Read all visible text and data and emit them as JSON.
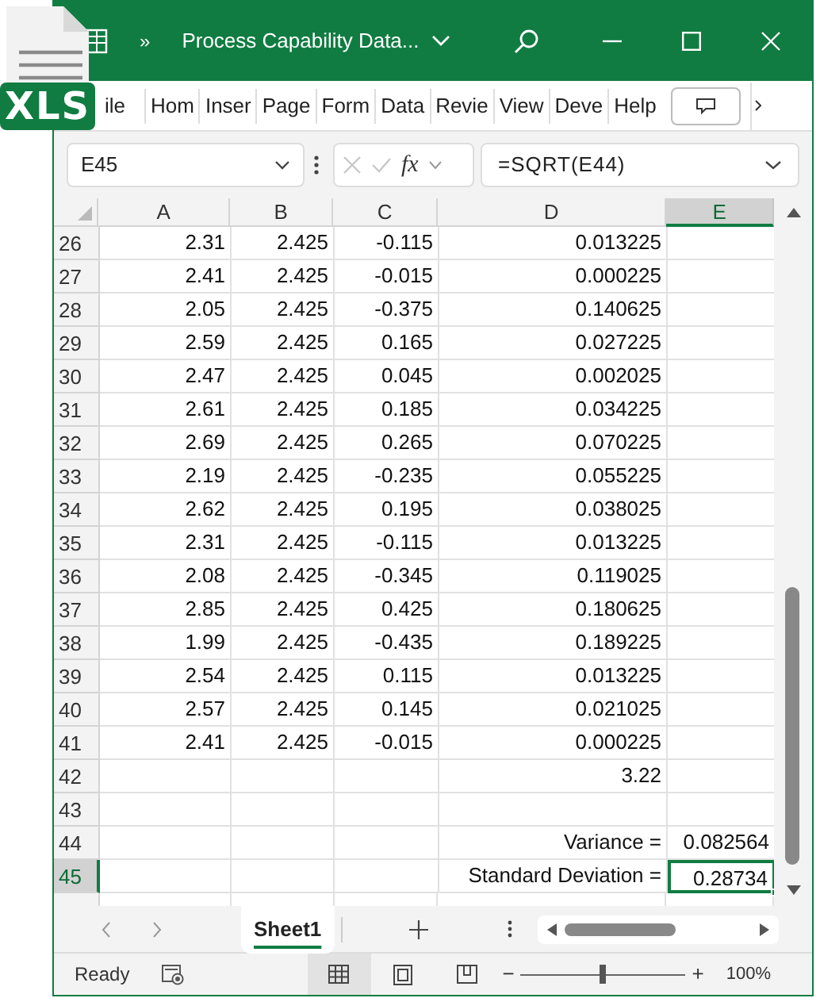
{
  "file_badge": {
    "label": "XLS"
  },
  "window": {
    "overflow": "»",
    "title": "Process Capability Data..."
  },
  "ribbon_tabs": [
    {
      "label": "ile"
    },
    {
      "label": "Hom"
    },
    {
      "label": "Inser"
    },
    {
      "label": "Page"
    },
    {
      "label": "Form"
    },
    {
      "label": "Data"
    },
    {
      "label": "Revie"
    },
    {
      "label": "View"
    },
    {
      "label": "Deve"
    },
    {
      "label": "Help"
    }
  ],
  "formula_bar": {
    "name_box": "E45",
    "fx": "fx",
    "formula": "=SQRT(E44)"
  },
  "columns": [
    {
      "label": "A",
      "selected": false
    },
    {
      "label": "B",
      "selected": false
    },
    {
      "label": "C",
      "selected": false
    },
    {
      "label": "D",
      "selected": false
    },
    {
      "label": "E",
      "selected": true
    }
  ],
  "rows": [
    {
      "number": "26",
      "selected": false,
      "cells": [
        "2.31",
        "2.425",
        "-0.115",
        "0.013225",
        ""
      ]
    },
    {
      "number": "27",
      "selected": false,
      "cells": [
        "2.41",
        "2.425",
        "-0.015",
        "0.000225",
        ""
      ]
    },
    {
      "number": "28",
      "selected": false,
      "cells": [
        "2.05",
        "2.425",
        "-0.375",
        "0.140625",
        ""
      ]
    },
    {
      "number": "29",
      "selected": false,
      "cells": [
        "2.59",
        "2.425",
        "0.165",
        "0.027225",
        ""
      ]
    },
    {
      "number": "30",
      "selected": false,
      "cells": [
        "2.47",
        "2.425",
        "0.045",
        "0.002025",
        ""
      ]
    },
    {
      "number": "31",
      "selected": false,
      "cells": [
        "2.61",
        "2.425",
        "0.185",
        "0.034225",
        ""
      ]
    },
    {
      "number": "32",
      "selected": false,
      "cells": [
        "2.69",
        "2.425",
        "0.265",
        "0.070225",
        ""
      ]
    },
    {
      "number": "33",
      "selected": false,
      "cells": [
        "2.19",
        "2.425",
        "-0.235",
        "0.055225",
        ""
      ]
    },
    {
      "number": "34",
      "selected": false,
      "cells": [
        "2.62",
        "2.425",
        "0.195",
        "0.038025",
        ""
      ]
    },
    {
      "number": "35",
      "selected": false,
      "cells": [
        "2.31",
        "2.425",
        "-0.115",
        "0.013225",
        ""
      ]
    },
    {
      "number": "36",
      "selected": false,
      "cells": [
        "2.08",
        "2.425",
        "-0.345",
        "0.119025",
        ""
      ]
    },
    {
      "number": "37",
      "selected": false,
      "cells": [
        "2.85",
        "2.425",
        "0.425",
        "0.180625",
        ""
      ]
    },
    {
      "number": "38",
      "selected": false,
      "cells": [
        "1.99",
        "2.425",
        "-0.435",
        "0.189225",
        ""
      ]
    },
    {
      "number": "39",
      "selected": false,
      "cells": [
        "2.54",
        "2.425",
        "0.115",
        "0.013225",
        ""
      ]
    },
    {
      "number": "40",
      "selected": false,
      "cells": [
        "2.57",
        "2.425",
        "0.145",
        "0.021025",
        ""
      ]
    },
    {
      "number": "41",
      "selected": false,
      "cells": [
        "2.41",
        "2.425",
        "-0.015",
        "0.000225",
        ""
      ]
    },
    {
      "number": "42",
      "selected": false,
      "cells": [
        "",
        "",
        "",
        "3.22",
        ""
      ]
    },
    {
      "number": "43",
      "selected": false,
      "cells": [
        "",
        "",
        "",
        "",
        ""
      ]
    },
    {
      "number": "44",
      "selected": false,
      "cells": [
        "",
        "",
        "",
        "Variance =",
        "0.082564"
      ]
    },
    {
      "number": "45",
      "selected": true,
      "cells": [
        "",
        "",
        "",
        "Standard Deviation =",
        "0.28734"
      ]
    }
  ],
  "sheet_tabs": [
    {
      "label": "Sheet1",
      "selected": true
    }
  ],
  "status_bar": {
    "status": "Ready",
    "zoom_out": "−",
    "zoom_in": "+",
    "zoom": "100%",
    "zoom_level": {
      "level": 0.5
    }
  }
}
